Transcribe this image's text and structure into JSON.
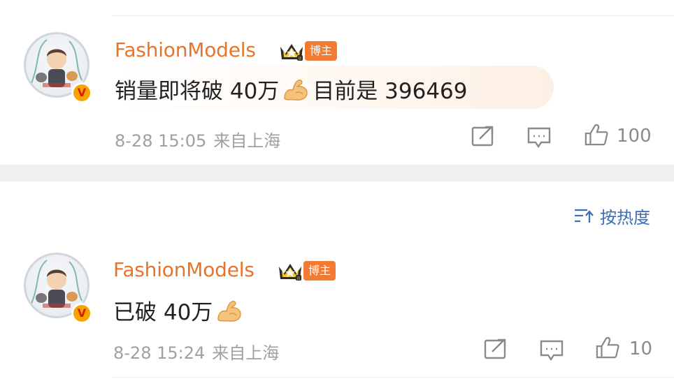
{
  "comments": [
    {
      "username": "FashionModels",
      "role_badge": "博主",
      "text_before": "销量即将破 40万",
      "text_after": "目前是 396469",
      "emoji": "flexed-biceps",
      "timestamp": "8-28 15:05",
      "location": "来自上海",
      "like_count": "100"
    },
    {
      "username": "FashionModels",
      "role_badge": "博主",
      "text_before": "已破 40万",
      "text_after": "",
      "emoji": "flexed-biceps",
      "timestamp": "8-28 15:24",
      "location": "来自上海",
      "like_count": "10"
    }
  ],
  "sort": {
    "label": "按热度",
    "icon": "sort-icon"
  },
  "colors": {
    "username": "#e8742a",
    "role_badge_bg": "#f27a32",
    "sort_accent": "#3f6db3",
    "meta_gray": "#a0a0a0",
    "verified_gold": "#f7a400"
  }
}
